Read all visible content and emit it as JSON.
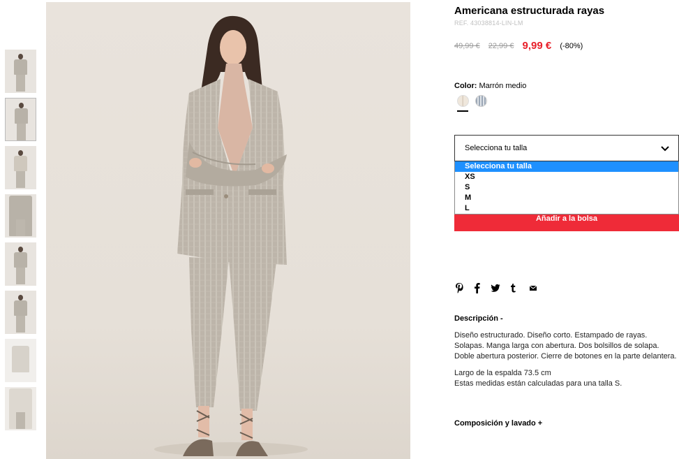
{
  "product": {
    "title": "Americana estructurada rayas",
    "ref": "REF. 43038814-LIN-LM",
    "price_original": "49,99 €",
    "price_previous": "22,99 €",
    "price_current": "9,99 €",
    "discount": "(-80%)"
  },
  "color": {
    "label": "Color:",
    "value": "Marrón medio",
    "swatches": [
      "beige-stripe-swatch",
      "blue-stripe-swatch"
    ]
  },
  "size": {
    "select_label": "Selecciona tu talla",
    "options": [
      "Selecciona tu talla",
      "XS",
      "S",
      "M",
      "L"
    ],
    "selected_index": 0
  },
  "cart": {
    "add_label": "Añadir a la bolsa"
  },
  "share_icons": [
    "pinterest-icon",
    "facebook-icon",
    "twitter-icon",
    "tumblr-icon",
    "email-icon"
  ],
  "description": {
    "title": "Descripción -",
    "paragraph1": "Diseño estructurado. Diseño corto. Estampado de rayas. Solapas. Manga larga con abertura. Dos bolsillos de solapa. Doble abertura posterior. Cierre de botones en la parte delantera.",
    "paragraph2_line1": "Largo de la espalda 73.5 cm",
    "paragraph2_line2": "Estas medidas están calculadas para una talla S."
  },
  "composition": {
    "title": "Composición y lavado +"
  },
  "colors": {
    "accent": "#ef2b38",
    "price_red": "#e8202a",
    "select_highlight": "#1e90ff"
  }
}
